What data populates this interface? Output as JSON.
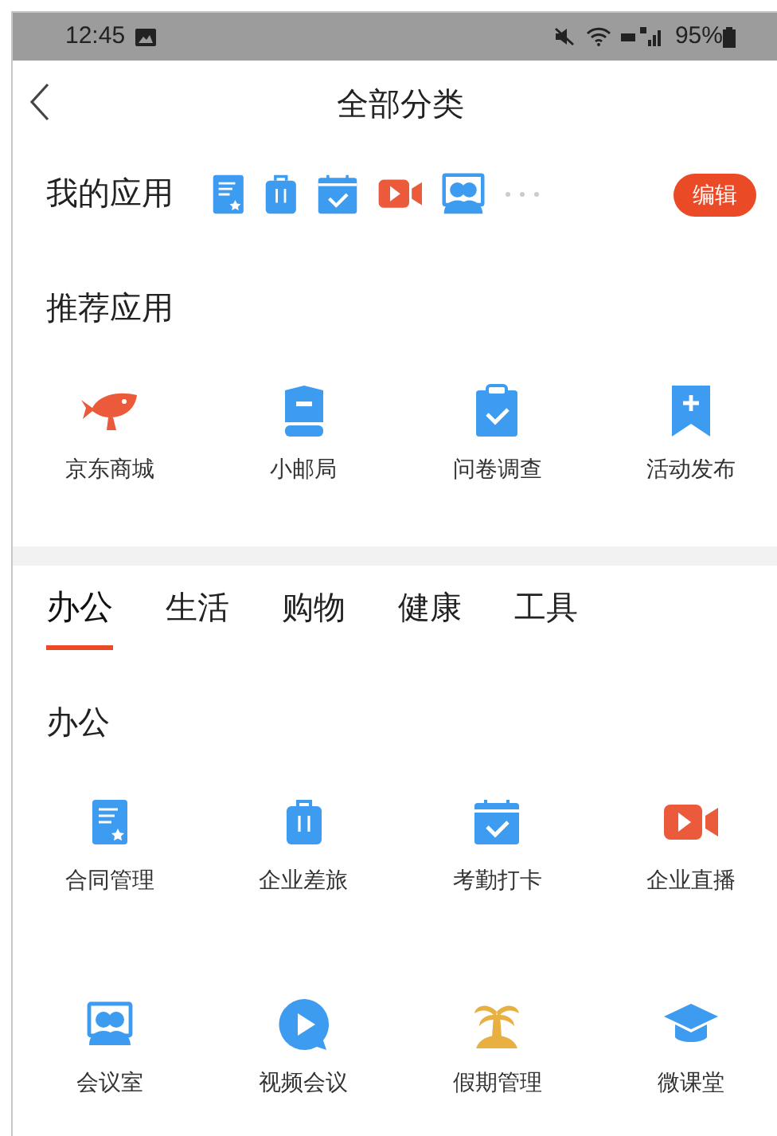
{
  "status_bar": {
    "time": "12:45",
    "battery": "95%"
  },
  "header": {
    "title": "全部分类"
  },
  "my_apps": {
    "title": "我的应用",
    "edit_button": "编辑"
  },
  "recommended": {
    "title": "推荐应用",
    "items": [
      {
        "label": "京东商城"
      },
      {
        "label": "小邮局"
      },
      {
        "label": "问卷调查"
      },
      {
        "label": "活动发布"
      }
    ]
  },
  "tabs": [
    {
      "label": "办公",
      "selected": true
    },
    {
      "label": "生活",
      "selected": false
    },
    {
      "label": "购物",
      "selected": false
    },
    {
      "label": "健康",
      "selected": false
    },
    {
      "label": "工具",
      "selected": false
    }
  ],
  "section": {
    "title": "办公",
    "items": [
      {
        "label": "合同管理"
      },
      {
        "label": "企业差旅"
      },
      {
        "label": "考勤打卡"
      },
      {
        "label": "企业直播"
      },
      {
        "label": "会议室"
      },
      {
        "label": "视频会议"
      },
      {
        "label": "假期管理"
      },
      {
        "label": "微课堂"
      }
    ]
  }
}
